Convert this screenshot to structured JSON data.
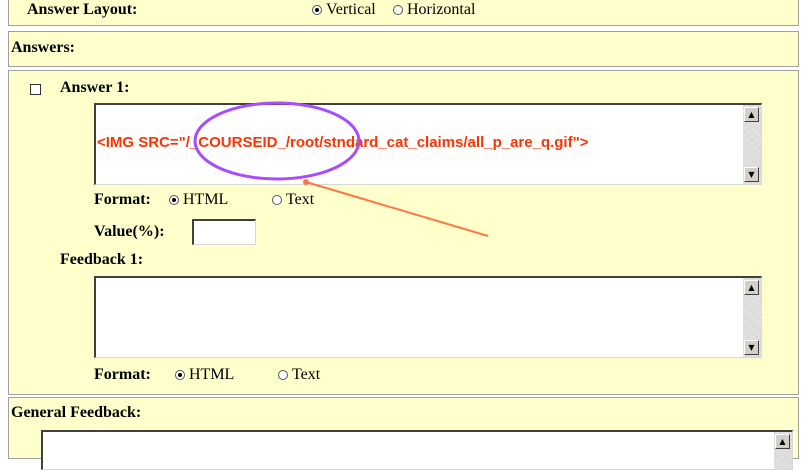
{
  "answer_layout": {
    "label": "Answer Layout:",
    "options": [
      "Vertical",
      "Horizontal"
    ],
    "selected": "Vertical"
  },
  "answers_section": {
    "title": "Answers:"
  },
  "answer1": {
    "label": "Answer 1:",
    "content": "<IMG SRC=\"/_COURSEID_/root/stndard_cat_claims/all_p_are_q.gif\">",
    "format_label": "Format:",
    "format_options": [
      "HTML",
      "Text"
    ],
    "format_selected": "HTML",
    "value_label": "Value(%):",
    "value": ""
  },
  "feedback1": {
    "label": "Feedback 1:",
    "content": "",
    "format_label": "Format:",
    "format_options": [
      "HTML",
      "Text"
    ],
    "format_selected": "HTML"
  },
  "general_feedback": {
    "label": "General Feedback:",
    "content": ""
  },
  "annotation": {
    "ellipse_color": "#a64dff",
    "arrow_color": "#ff7744"
  },
  "colors": {
    "panel_bg": "#ffffcc",
    "code_text": "#ff3300"
  }
}
